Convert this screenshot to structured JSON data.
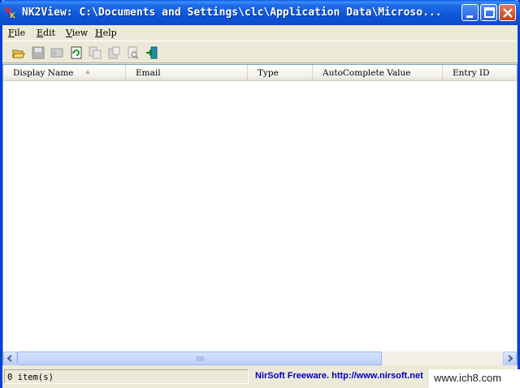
{
  "window": {
    "title": "NK2View:  C:\\Documents and Settings\\clc\\Application Data\\Microso..."
  },
  "menu": {
    "items": [
      {
        "label": "File",
        "underline": "F",
        "rest": "ile"
      },
      {
        "label": "Edit",
        "underline": "E",
        "rest": "dit"
      },
      {
        "label": "View",
        "underline": "V",
        "rest": "iew"
      },
      {
        "label": "Help",
        "underline": "H",
        "rest": "elp"
      }
    ]
  },
  "toolbar": {
    "icons": [
      "open-folder-icon",
      "save-icon",
      "properties-icon",
      "refresh-icon",
      "copy-icon",
      "paste-icon",
      "find-icon",
      "exit-icon"
    ]
  },
  "list": {
    "columns": [
      "Display Name",
      "Email",
      "Type",
      "AutoComplete Value",
      "Entry ID"
    ],
    "rows": []
  },
  "status": {
    "items_count": "0 item(s)",
    "credit": "NirSoft Freeware.  http://www.nirsoft.net"
  },
  "watermark": "www.ich8.com",
  "colors": {
    "titlebar": "#0c4bcc",
    "credit_text": "#0000c0"
  }
}
